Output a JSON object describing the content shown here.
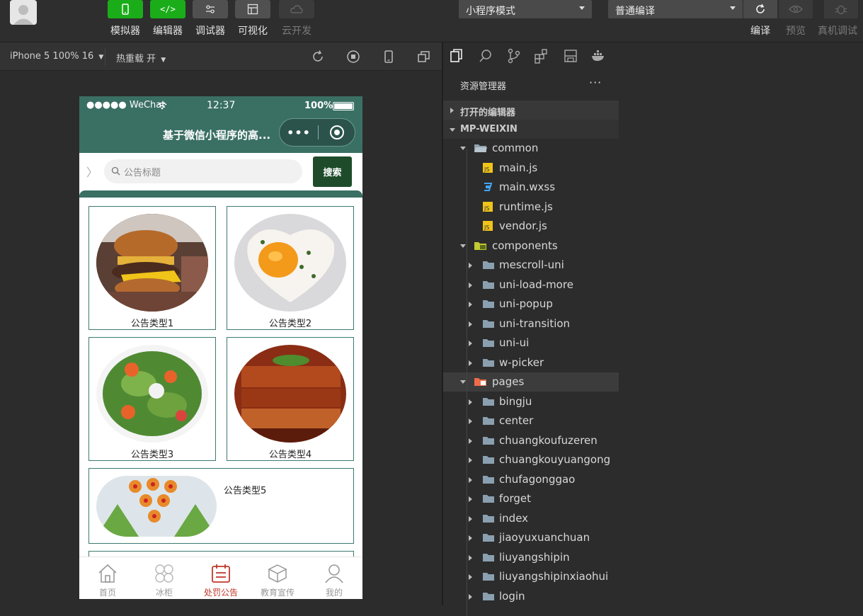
{
  "toolbar": {
    "buttons": [
      {
        "label": "模拟器",
        "icon": "phone-icon"
      },
      {
        "label": "编辑器",
        "icon": "code-icon"
      },
      {
        "label": "调试器",
        "icon": "sliders-icon"
      },
      {
        "label": "可视化",
        "icon": "layout-icon"
      },
      {
        "label": "云开发",
        "icon": "cloud-icon"
      }
    ],
    "mode_select": "小程序模式",
    "compile_select": "普通编译",
    "right_labels": {
      "compile": "编译",
      "preview": "预览",
      "remote_debug": "真机调试"
    }
  },
  "simulator": {
    "device": "iPhone 5 100% 16",
    "hot_reload": "热重载 开"
  },
  "phone": {
    "status": {
      "carrier": "●●●●● WeChat",
      "time": "12:37",
      "battery": "100%"
    },
    "nav_title": "基于微信小程序的高...",
    "search_placeholder": "公告标题",
    "search_button": "搜索",
    "cards": [
      "公告类型1",
      "公告类型2",
      "公告类型3",
      "公告类型4",
      "公告类型5"
    ],
    "tabs": [
      {
        "label": "首页",
        "icon": "home-icon"
      },
      {
        "label": "冰柜",
        "icon": "grid-icon"
      },
      {
        "label": "处罚公告",
        "icon": "notice-icon"
      },
      {
        "label": "教育宣传",
        "icon": "box-icon"
      },
      {
        "label": "我的",
        "icon": "user-icon"
      }
    ]
  },
  "explorer": {
    "title": "资源管理器",
    "more": "···",
    "open_editors": "打开的编辑器",
    "project": "MP-WEIXIN",
    "tree": [
      {
        "label": "common",
        "type": "folder-open"
      },
      {
        "label": "main.js",
        "type": "js"
      },
      {
        "label": "main.wxss",
        "type": "css"
      },
      {
        "label": "runtime.js",
        "type": "js"
      },
      {
        "label": "vendor.js",
        "type": "js"
      },
      {
        "label": "components",
        "type": "folder-special"
      },
      {
        "label": "mescroll-uni",
        "type": "folder"
      },
      {
        "label": "uni-load-more",
        "type": "folder"
      },
      {
        "label": "uni-popup",
        "type": "folder"
      },
      {
        "label": "uni-transition",
        "type": "folder"
      },
      {
        "label": "uni-ui",
        "type": "folder"
      },
      {
        "label": "w-picker",
        "type": "folder"
      },
      {
        "label": "pages",
        "type": "folder-pages"
      },
      {
        "label": "bingju",
        "type": "folder"
      },
      {
        "label": "center",
        "type": "folder"
      },
      {
        "label": "chuangkoufuzeren",
        "type": "folder"
      },
      {
        "label": "chuangkouyuangong",
        "type": "folder"
      },
      {
        "label": "chufagonggao",
        "type": "folder"
      },
      {
        "label": "forget",
        "type": "folder"
      },
      {
        "label": "index",
        "type": "folder"
      },
      {
        "label": "jiaoyuxuanchuan",
        "type": "folder"
      },
      {
        "label": "liuyangshipin",
        "type": "folder"
      },
      {
        "label": "liuyangshipinxiaohui",
        "type": "folder"
      },
      {
        "label": "login",
        "type": "folder"
      }
    ]
  }
}
